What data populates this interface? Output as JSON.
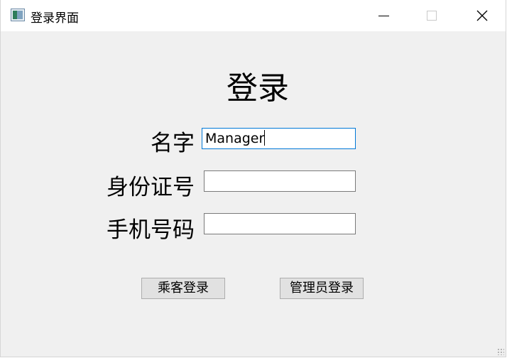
{
  "window": {
    "title": "登录界面",
    "controls": {
      "minimize": "minimize",
      "maximize": "maximize",
      "close": "close"
    }
  },
  "form": {
    "heading": "登录",
    "fields": [
      {
        "label": "名字",
        "value": "Manager",
        "focused": true
      },
      {
        "label": "身份证号",
        "value": ""
      },
      {
        "label": "手机号码",
        "value": ""
      }
    ]
  },
  "buttons": {
    "passenger_login": "乘客登录",
    "admin_login": "管理员登录"
  },
  "icons": {
    "app": "app-window-icon",
    "minimize": "minimize-icon",
    "maximize": "maximize-icon",
    "close": "close-icon"
  },
  "colors": {
    "window_bg": "#f0f0f0",
    "titlebar_bg": "#ffffff",
    "focus_border": "#0078d7",
    "button_bg": "#e1e1e1"
  }
}
